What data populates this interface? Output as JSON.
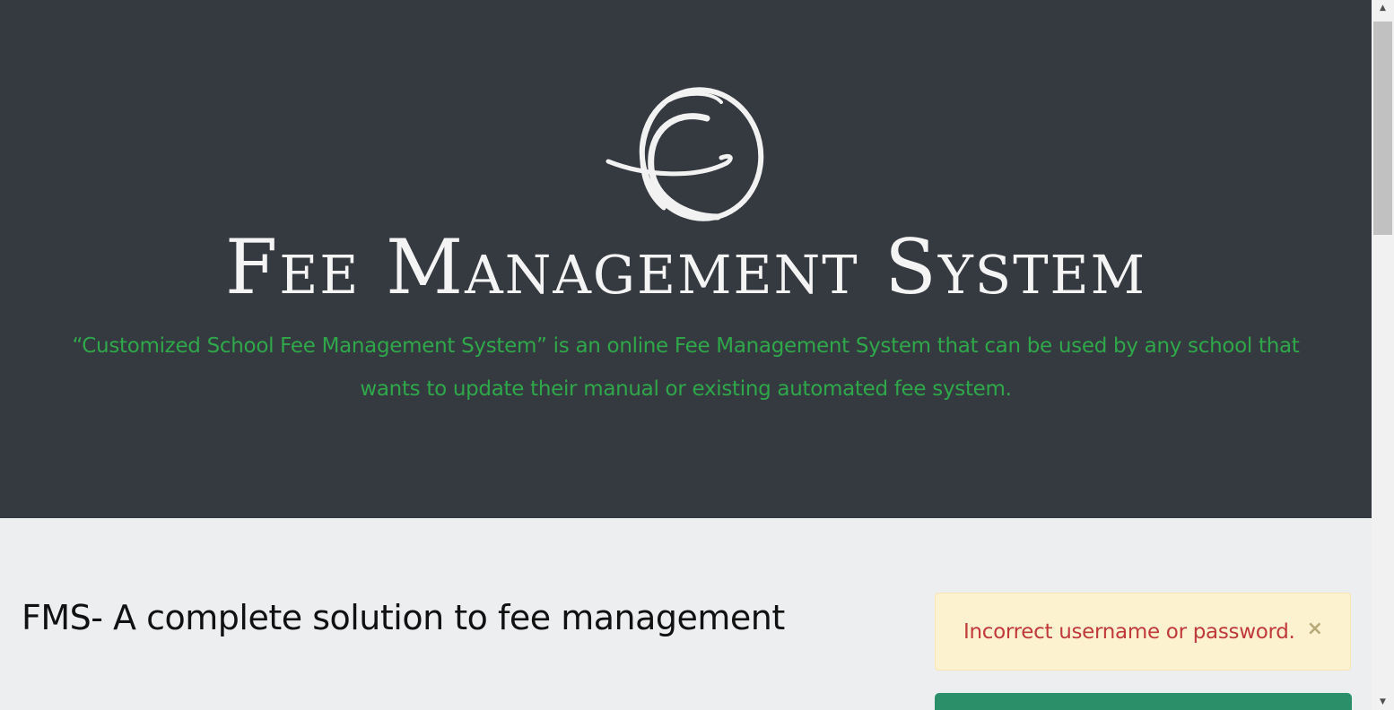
{
  "hero": {
    "logo_icon": "swirl-circle-logo-icon",
    "title": "Fee Management System",
    "description": "“Customized School Fee Management System” is an online Fee Management System that can be used by any school that wants to update their manual or existing automated fee system."
  },
  "main": {
    "heading": "FMS- A complete solution to fee management"
  },
  "alert": {
    "message": "Incorrect username or password.",
    "close_label": "×"
  },
  "colors": {
    "hero_bg": "#353940",
    "accent_green": "#2fa84a",
    "alert_bg": "#fdf2cf",
    "alert_text": "#c0393b",
    "panel_green": "#2b8f6a"
  },
  "scrollbar": {
    "up_arrow": "▲",
    "down_arrow": "▼"
  }
}
